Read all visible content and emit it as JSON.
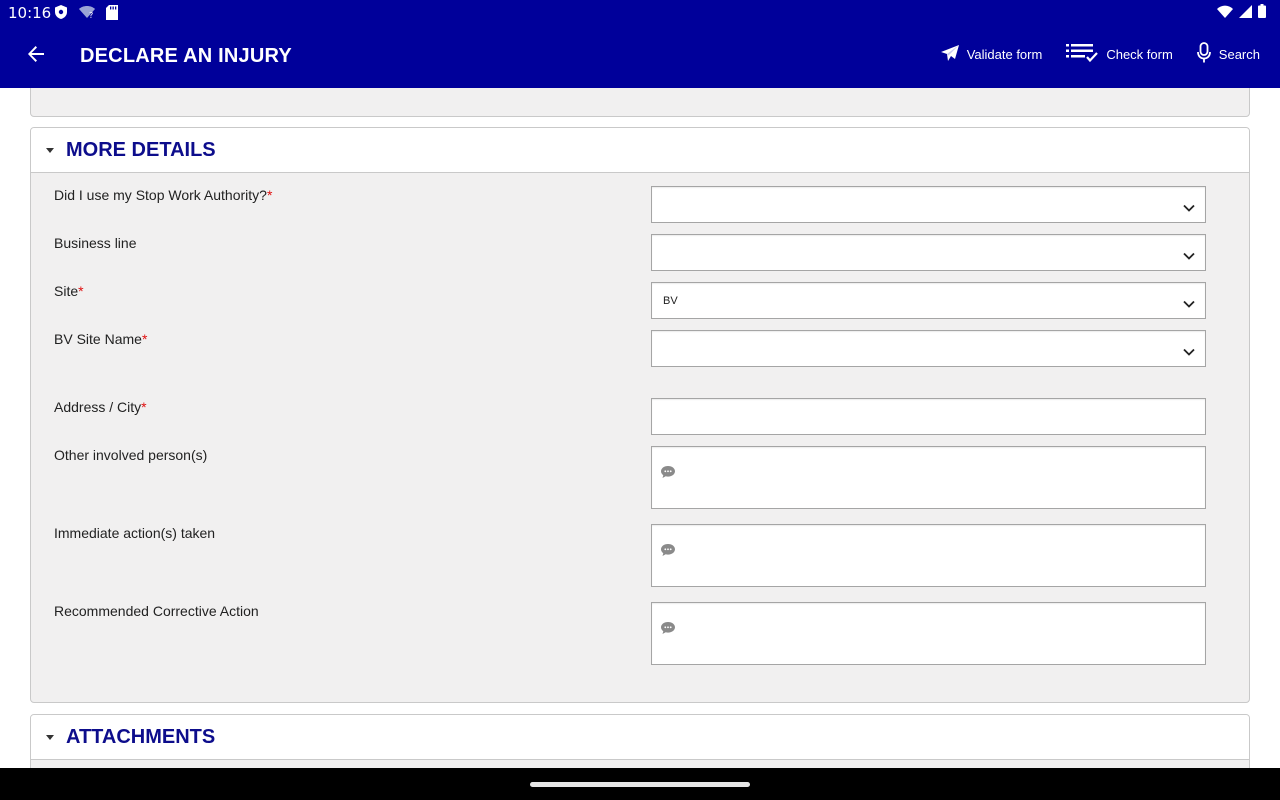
{
  "status_bar": {
    "time": "10:16",
    "icons": [
      "shield-icon",
      "wifi-question-icon",
      "sd-card-icon"
    ],
    "right_icons": [
      "wifi-icon",
      "signal-icon",
      "battery-icon"
    ]
  },
  "app_bar": {
    "title": "DECLARE AN INJURY",
    "actions": {
      "validate": "Validate form",
      "check": "Check form",
      "search": "Search"
    }
  },
  "more_details": {
    "title": "MORE DETAILS",
    "fields": {
      "stop_work": {
        "label": "Did I use my Stop Work Authority?",
        "required_mark": "*",
        "value": ""
      },
      "business_line": {
        "label": "Business line",
        "value": ""
      },
      "site": {
        "label": "Site",
        "required_mark": "*",
        "value": "BV"
      },
      "bv_site_name": {
        "label": "BV Site Name",
        "required_mark": "*",
        "value": ""
      },
      "address_city": {
        "label": "Address / City",
        "required_mark": "*",
        "value": ""
      },
      "other_persons": {
        "label": "Other involved person(s)",
        "value": ""
      },
      "immediate_actions": {
        "label": "Immediate action(s) taken",
        "value": ""
      },
      "corrective_action": {
        "label": "Recommended Corrective Action",
        "value": ""
      }
    }
  },
  "attachments": {
    "title": "ATTACHMENTS"
  },
  "colors": {
    "primary": "#00009a",
    "section_title": "#0d0d8c",
    "required": "#e01010",
    "panel_bg": "#f1f0f0"
  }
}
